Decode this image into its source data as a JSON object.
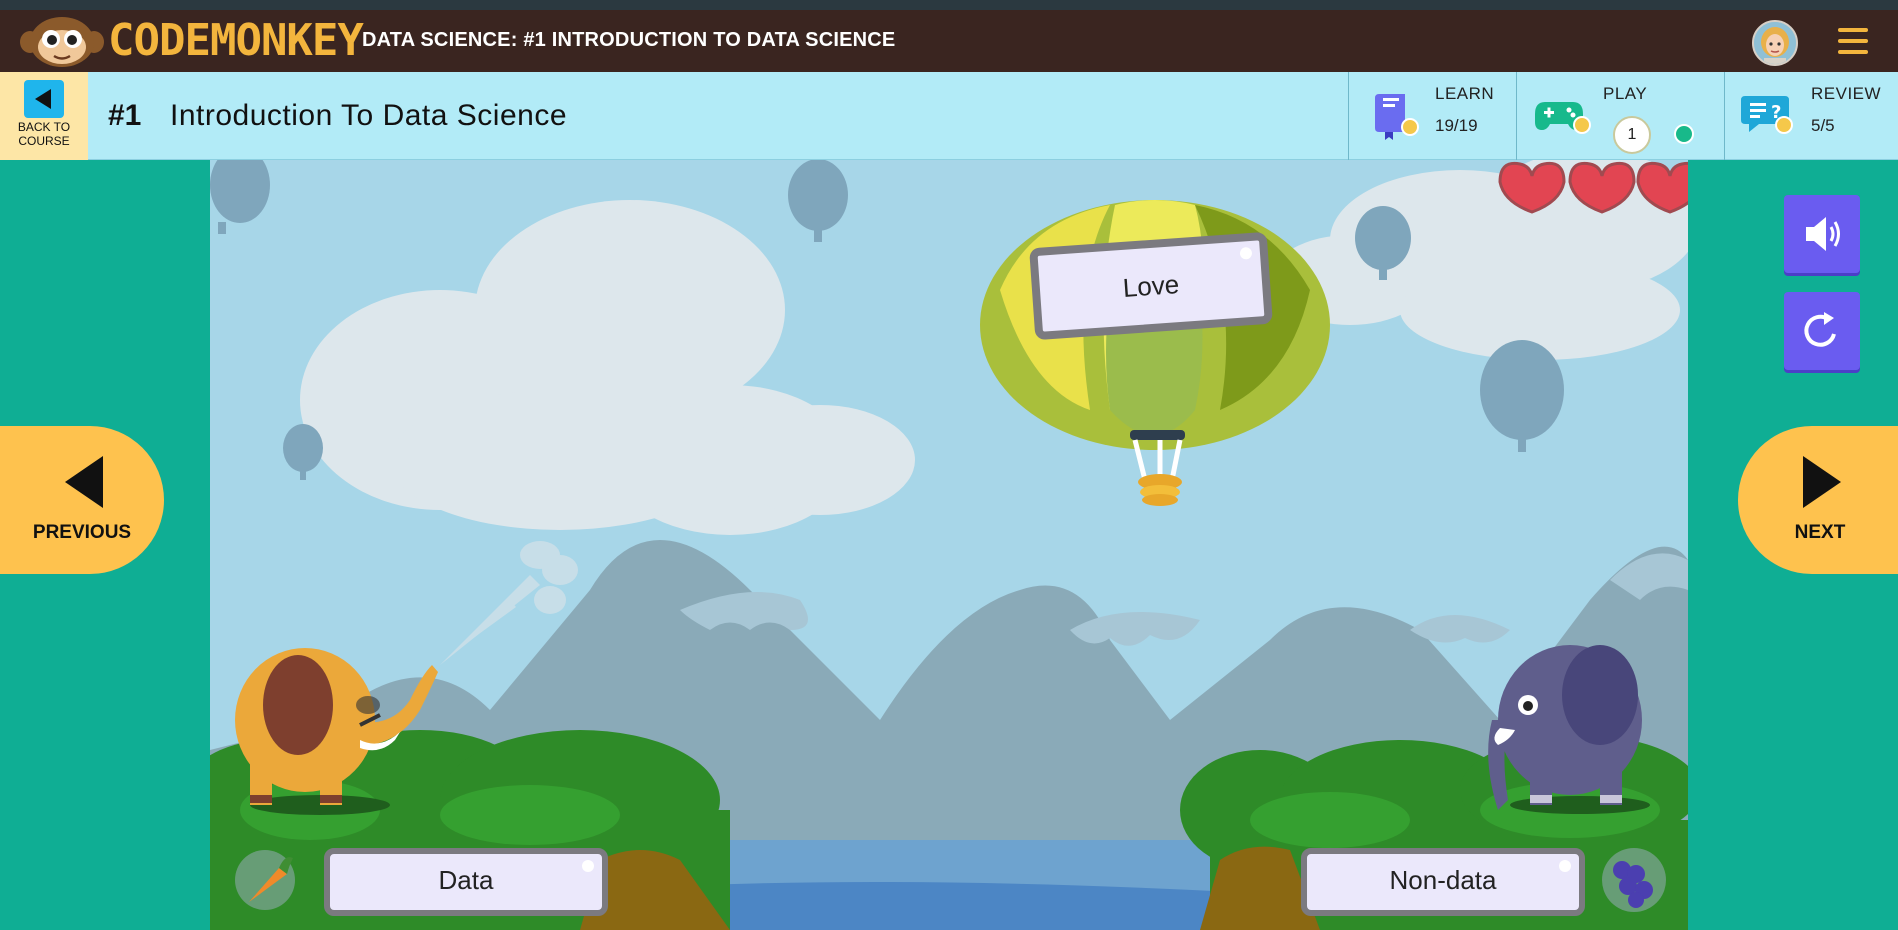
{
  "header": {
    "brand": "CODEMONKEY",
    "course_title": "DATA SCIENCE: #1 INTRODUCTION TO DATA SCIENCE"
  },
  "lesson": {
    "back_label_line1": "BACK TO",
    "back_label_line2": "COURSE",
    "number": "#1",
    "title": "Introduction To Data Science",
    "learn": {
      "label": "LEARN",
      "value": "19/19"
    },
    "play": {
      "label": "PLAY",
      "value": "1"
    },
    "review": {
      "label": "REVIEW",
      "value": "5/5"
    }
  },
  "game": {
    "balloon_word": "Love",
    "left_bin": "Data",
    "right_bin": "Non-data",
    "lives": 3
  },
  "nav": {
    "previous": "PREVIOUS",
    "next": "NEXT"
  },
  "colors": {
    "header_bg": "#3a2520",
    "brand": "#f3b53d",
    "lesson_bar": "#b2ebf7",
    "page_bg": "#0fae94",
    "nav_button": "#fec24e",
    "action_button": "#6a5cf0"
  },
  "icons": {
    "back": "back-arrow-icon",
    "learn": "book-icon",
    "play": "gamepad-icon",
    "review": "chat-question-icon",
    "sound": "speaker-icon",
    "restart": "restart-icon",
    "menu": "hamburger-menu-icon"
  }
}
